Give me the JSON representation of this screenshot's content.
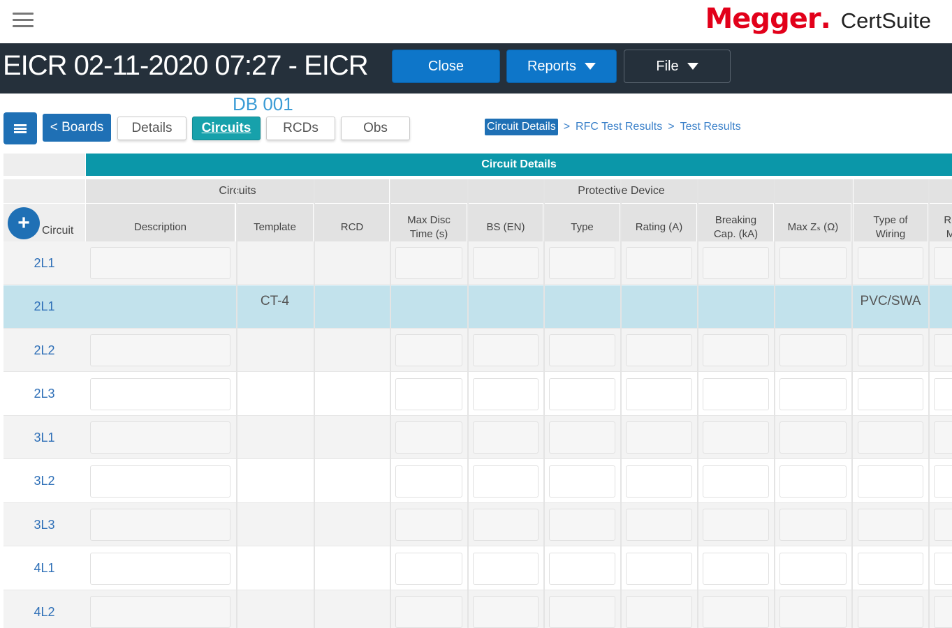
{
  "brand": {
    "name": "Megger",
    "product": "CertSuite",
    "color": "#e2001a"
  },
  "header": {
    "title": "EICR 02-11-2020 07:27 - EICR",
    "close_label": "Close",
    "reports_label": "Reports",
    "file_label": "File"
  },
  "board": {
    "name": "DB 001"
  },
  "nav": {
    "boards_label": "< Boards",
    "tabs": [
      "Details",
      "Circuits",
      "RCDs",
      "Obs"
    ],
    "active_tab": "Circuits"
  },
  "breadcrumb": {
    "items": [
      "Circuit Details",
      "RFC Test Results",
      "Test Results"
    ],
    "separator": ">"
  },
  "grid": {
    "band_title": "Circuit Details",
    "groups": {
      "circuits": "Circuits",
      "protective_device": "Protective Device"
    },
    "circuit_header": "Circuit",
    "columns": [
      "Description",
      "Template",
      "RCD",
      "Max Disc\nTime (s)",
      "BS (EN)",
      "Type",
      "Rating (A)",
      "Breaking\nCap. (kA)",
      "Max Zₛ (Ω)",
      "Type of\nWiring",
      "Re\nM"
    ],
    "rows": [
      {
        "circuit": "2L1",
        "template": "",
        "wiring": ""
      },
      {
        "circuit": "2L1",
        "template": "CT-4",
        "wiring": "PVC/SWA",
        "selected": true
      },
      {
        "circuit": "2L2",
        "template": "",
        "wiring": ""
      },
      {
        "circuit": "2L3",
        "template": "",
        "wiring": ""
      },
      {
        "circuit": "3L1",
        "template": "",
        "wiring": ""
      },
      {
        "circuit": "3L2",
        "template": "",
        "wiring": ""
      },
      {
        "circuit": "3L3",
        "template": "",
        "wiring": ""
      },
      {
        "circuit": "4L1",
        "template": "",
        "wiring": ""
      },
      {
        "circuit": "4L2",
        "template": "",
        "wiring": ""
      }
    ]
  },
  "colors": {
    "accent_blue": "#1f70b5",
    "teal": "#0b97a9",
    "title_bar": "#25303b",
    "selected_row": "#c2e2ec"
  }
}
